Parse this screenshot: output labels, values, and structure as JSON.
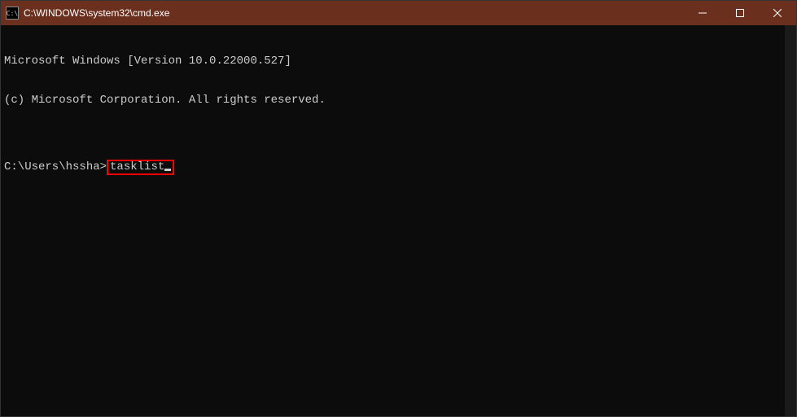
{
  "titlebar": {
    "icon_label": "C:\\",
    "title": "C:\\WINDOWS\\system32\\cmd.exe",
    "minimize": "─",
    "maximize": "▢",
    "close": "✕"
  },
  "terminal": {
    "line1": "Microsoft Windows [Version 10.0.22000.527]",
    "line2": "(c) Microsoft Corporation. All rights reserved.",
    "blank": "",
    "prompt": "C:\\Users\\hssha>",
    "command": "tasklist"
  }
}
